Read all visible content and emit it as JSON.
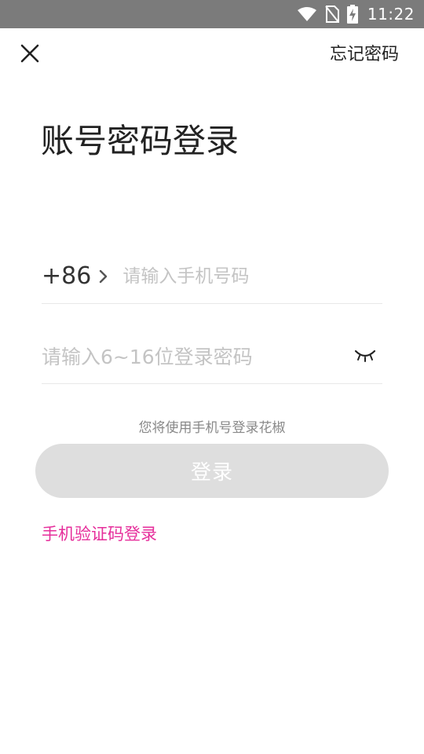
{
  "status_bar": {
    "time": "11:22",
    "icons": [
      "wifi-icon",
      "no-sim-icon",
      "battery-charging-icon"
    ]
  },
  "header": {
    "close_icon": "close-icon",
    "forgot_password": "忘记密码"
  },
  "title": "账号密码登录",
  "phone": {
    "country_code": "+86",
    "placeholder": "请输入手机号码",
    "value": ""
  },
  "password": {
    "placeholder": "请输入6~16位登录密码",
    "value": "",
    "toggle_icon": "eye-closed-icon"
  },
  "hint": "您将使用手机号登录花椒",
  "login_button": "登录",
  "sms_login": "手机验证码登录",
  "colors": {
    "status_bar": "#7b7b7b",
    "accent": "#e62e9b",
    "button_disabled": "#dedede",
    "placeholder": "#c4c4c4"
  }
}
